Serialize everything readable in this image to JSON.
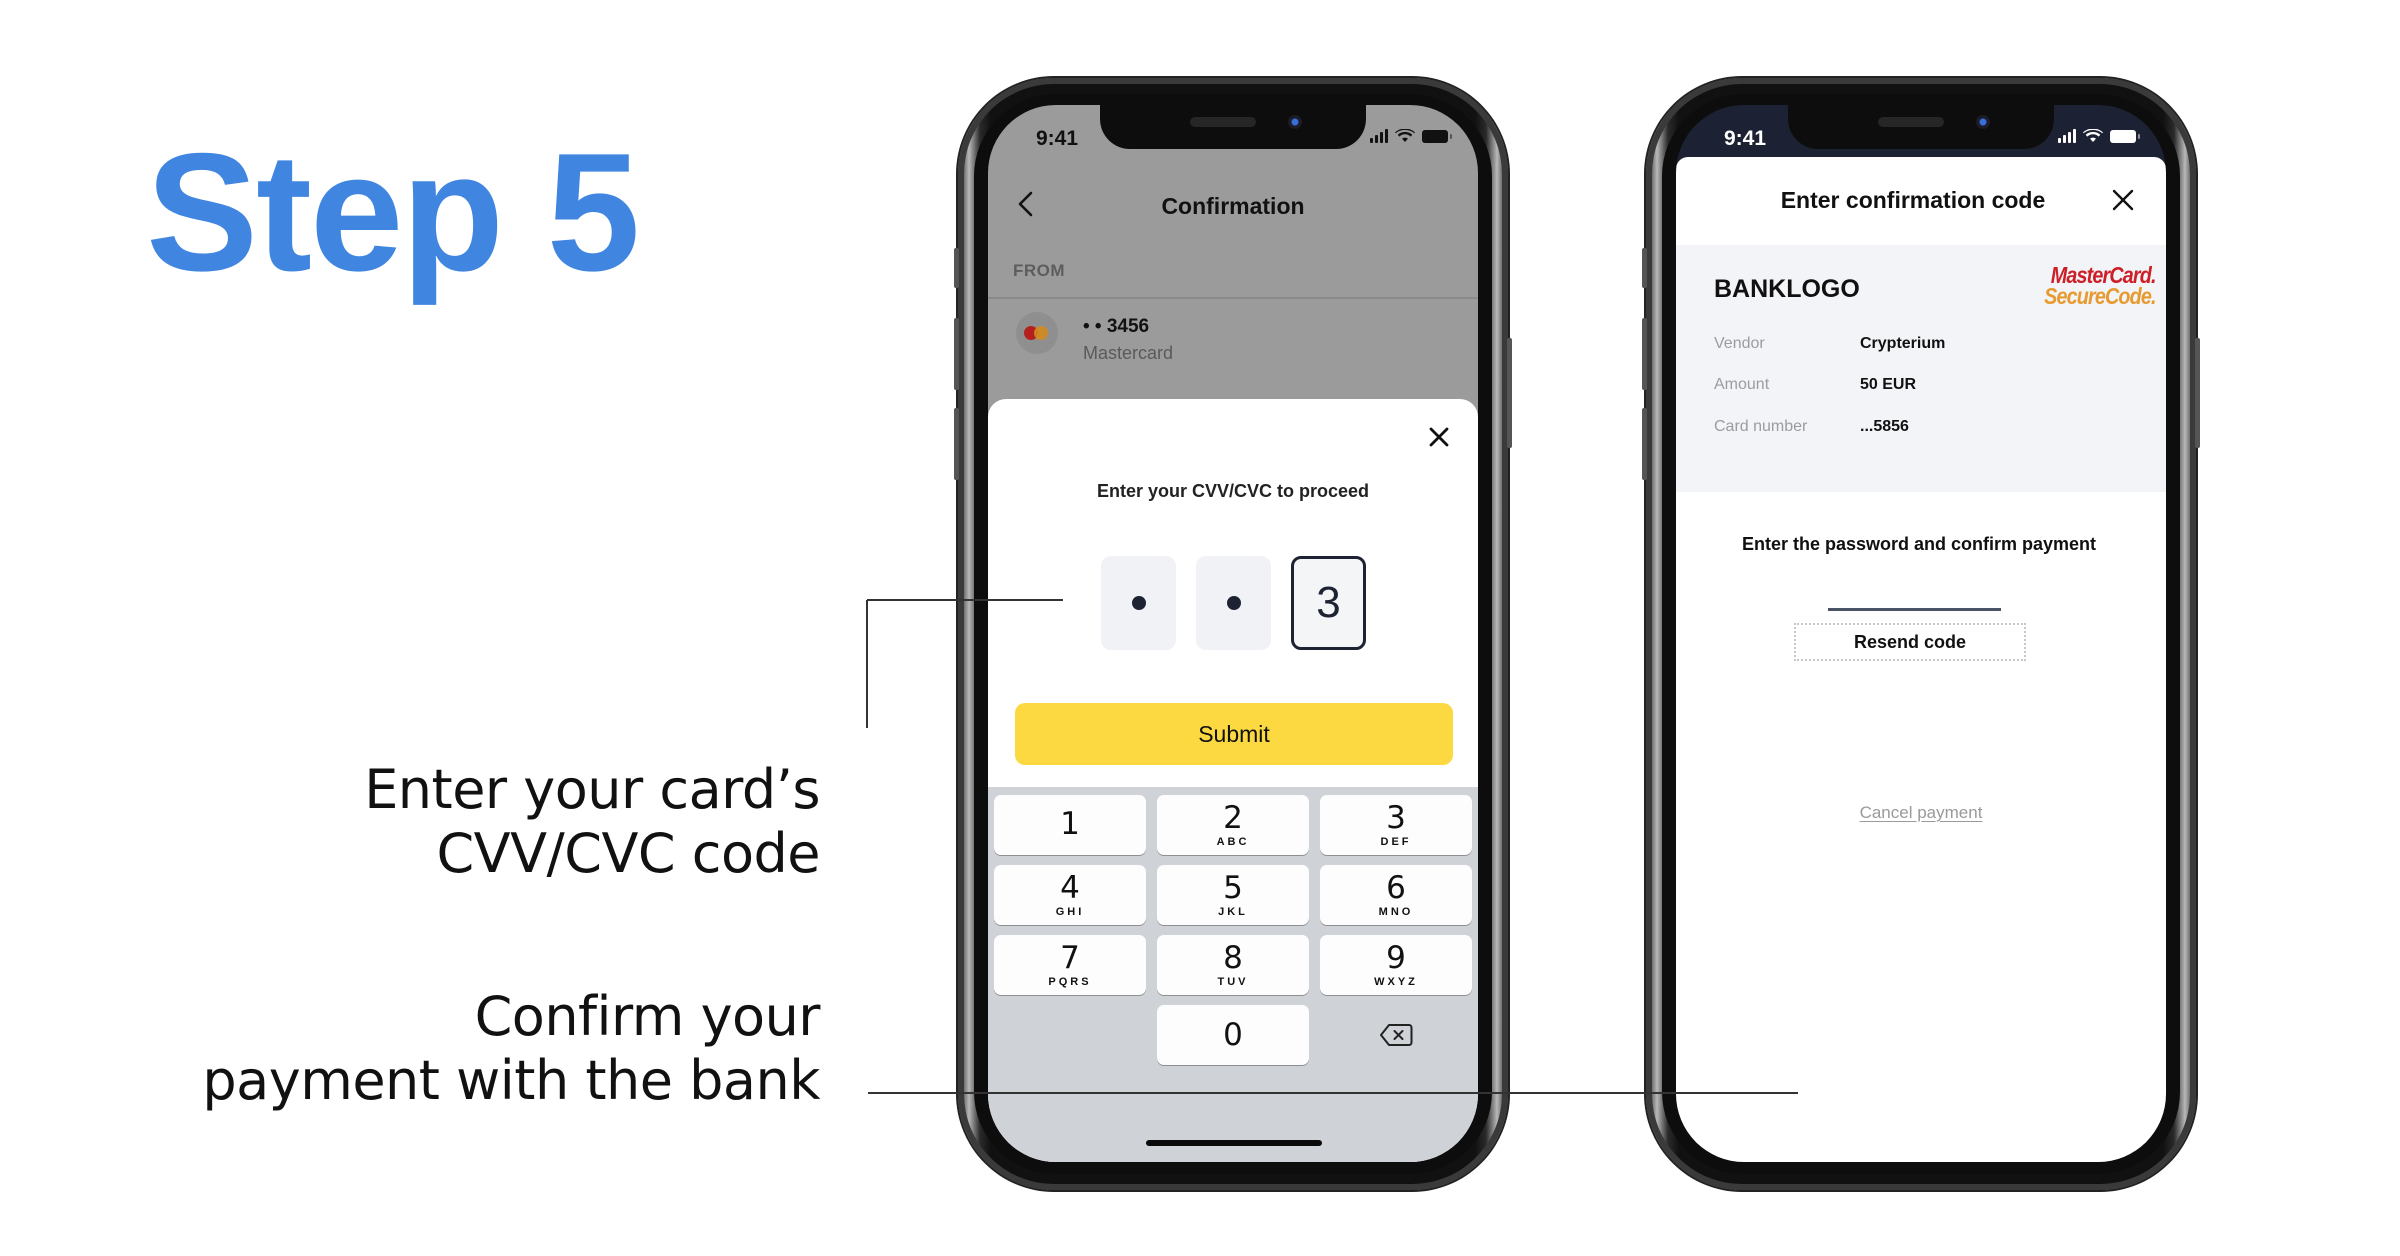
{
  "title": "Step 5",
  "colors": {
    "title_blue": "#4086E0",
    "submit_yellow": "#FCD941",
    "mastercard_red": "#CC1F27",
    "securecode_orange": "#E69A2F"
  },
  "annotations": [
    {
      "lines": [
        "Enter your card’s",
        "CVV/CVC code"
      ]
    },
    {
      "lines": [
        "Confirm your",
        "payment with the bank"
      ]
    }
  ],
  "phone1": {
    "status_time": "9:41",
    "status_icons": [
      "cellular-signal-icon",
      "wifi-icon",
      "battery-icon"
    ],
    "header": {
      "back_icon": "chevron-left-icon",
      "title": "Confirmation"
    },
    "from_label": "FROM",
    "card": {
      "icon": "mastercard-icon",
      "number": "• • 3456",
      "type": "Mastercard"
    },
    "sheet": {
      "close_icon": "close-icon",
      "prompt": "Enter your CVV/CVC to proceed",
      "cvv_digits": [
        {
          "state": "masked",
          "value": ""
        },
        {
          "state": "masked",
          "value": ""
        },
        {
          "state": "active",
          "value": "3"
        }
      ],
      "submit_label": "Submit"
    },
    "keypad": [
      {
        "digit": "1",
        "letters": ""
      },
      {
        "digit": "2",
        "letters": "ABC"
      },
      {
        "digit": "3",
        "letters": "DEF"
      },
      {
        "digit": "4",
        "letters": "GHI"
      },
      {
        "digit": "5",
        "letters": "JKL"
      },
      {
        "digit": "6",
        "letters": "MNO"
      },
      {
        "digit": "7",
        "letters": "PQRS"
      },
      {
        "digit": "8",
        "letters": "TUV"
      },
      {
        "digit": "9",
        "letters": "WXYZ"
      },
      {
        "digit": "0",
        "letters": ""
      }
    ],
    "delete_icon": "backspace-icon"
  },
  "phone2": {
    "status_time": "9:41",
    "title": "Enter confirmation code",
    "close_icon": "close-icon",
    "bank_logo": "BANKLOGO",
    "secure_logo": {
      "line1": "MasterCard.",
      "line2": "SecureCode."
    },
    "details": [
      {
        "label": "Vendor",
        "value": "Crypterium"
      },
      {
        "label": "Amount",
        "value": "50 EUR"
      },
      {
        "label": "Card number",
        "value": "...5856"
      }
    ],
    "prompt": "Enter the password and confirm payment",
    "password_value": "",
    "resend_label": "Resend code",
    "cancel_label": "Cancel payment"
  }
}
